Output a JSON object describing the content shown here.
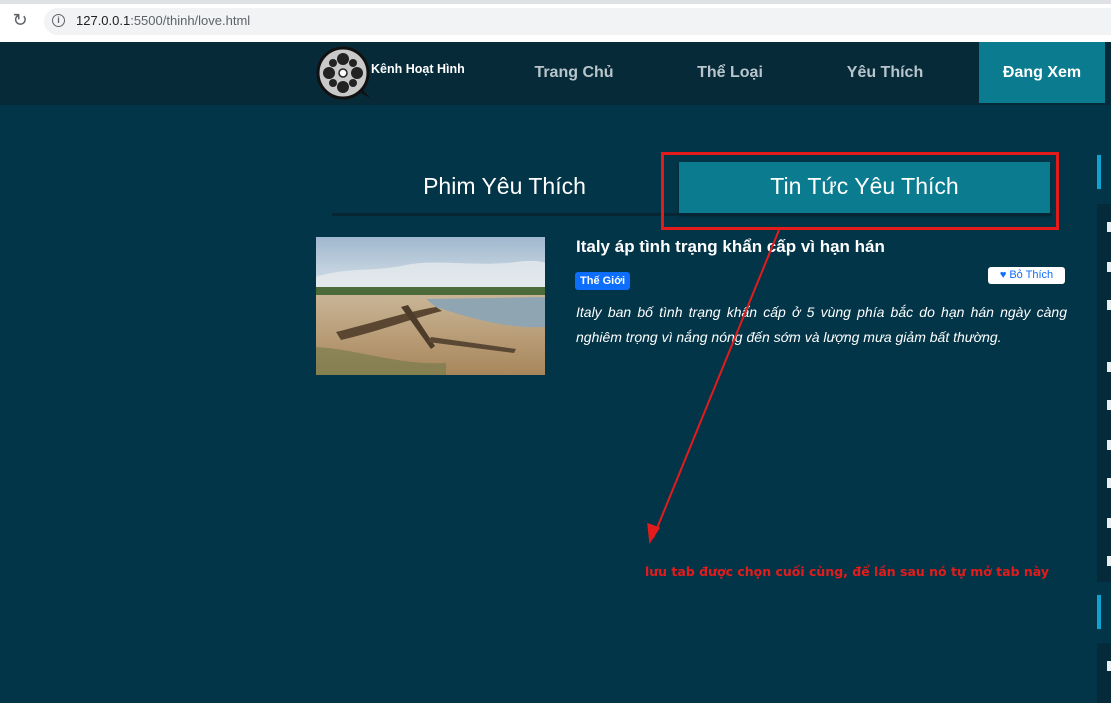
{
  "browser": {
    "url_host": "127.0.0.1",
    "url_path": ":5500/thinh/love.html"
  },
  "navbar": {
    "brand": "Kênh Hoạt Hình",
    "items": [
      {
        "label": "Trang Chủ"
      },
      {
        "label": "Thể Loại"
      },
      {
        "label": "Yêu Thích"
      },
      {
        "label": "Đang Xem"
      }
    ],
    "active_item": "Đang Xem"
  },
  "tabs": {
    "movies_label": "Phim Yêu Thích",
    "news_label": "Tin Tức Yêu Thích",
    "selected": "Tin Tức Yêu Thích"
  },
  "article": {
    "title": "Italy áp tình trạng khẩn cấp vì hạn hán",
    "category": "Thế Giới",
    "unlike_label": "Bỏ Thích",
    "description": "Italy ban bố tình trạng khẩn cấp ở 5 vùng phía bắc do hạn hán ngày càng nghiêm trọng vì nắng nóng đến sớm và lượng mưa giảm bất thường."
  },
  "annotation": {
    "note": "lưu tab được chọn cuối cùng, để lần sau nó tự mở tab này",
    "color": "#e41b1b"
  },
  "colors": {
    "page_bg": "#033548",
    "navbar_bg": "#062a38",
    "accent": "#0b7c90",
    "badge": "#0d6efd"
  }
}
